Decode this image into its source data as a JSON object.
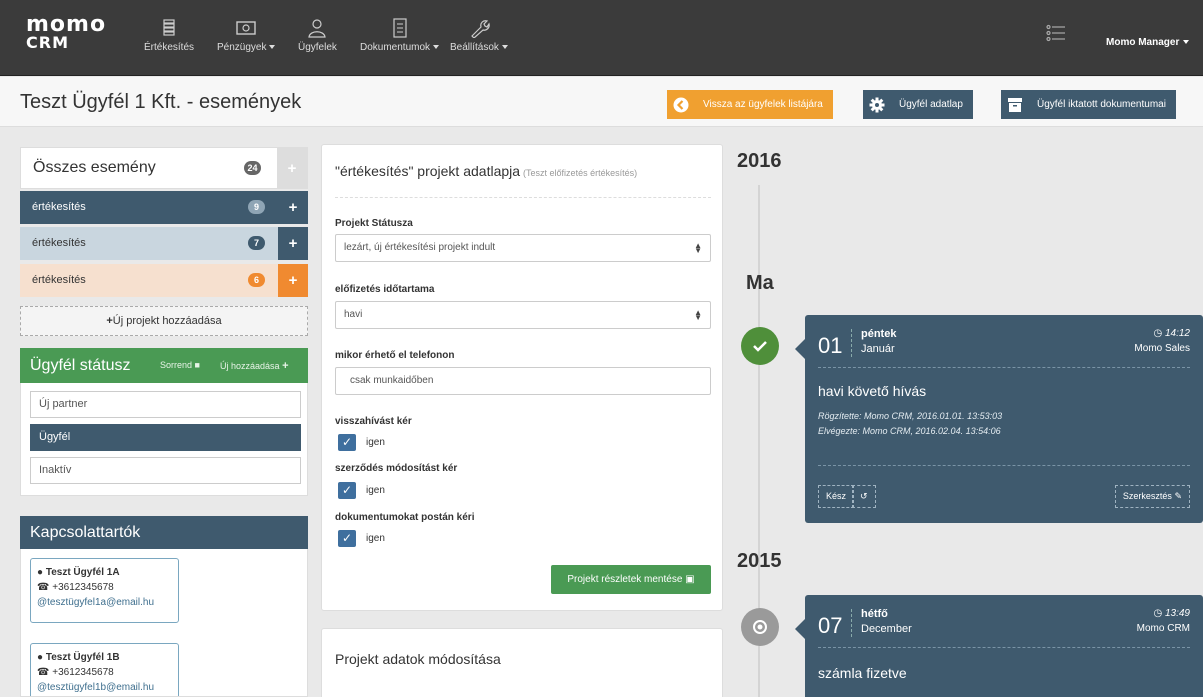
{
  "nav": {
    "logo_line1": "momo",
    "logo_line2": "CRM",
    "items": [
      {
        "label": "Értékesítés"
      },
      {
        "label": "Pénzügyek"
      },
      {
        "label": "Ügyfelek"
      },
      {
        "label": "Dokumentumok"
      },
      {
        "label": "Beállítások"
      }
    ],
    "user": "Momo Manager"
  },
  "header": {
    "title": "Teszt Ügyfél 1 Kft. - események",
    "back_label": "Vissza az ügyfelek listájára",
    "client_sheet_label": "Ügyfél adatlap",
    "documents_label": "Ügyfél iktatott dokumentumai",
    "colors": {
      "orange": "#f0a030",
      "blue": "#3f5a6e"
    }
  },
  "events_list": {
    "all_label": "Összes esemény",
    "all_count": "24",
    "projects": [
      {
        "label": "értékesítés",
        "count": "9",
        "color": "#3f5a6e"
      },
      {
        "label": "értékesítés",
        "count": "7",
        "color": "#c9d6df"
      },
      {
        "label": "értékesítés",
        "count": "6",
        "color": "#f6e0cf"
      }
    ],
    "add_project_label": "Új projekt hozzáadása"
  },
  "client_status": {
    "title": "Ügyfél státusz",
    "order_label": "Sorrend",
    "add_label": "Új hozzáadása",
    "items": [
      "Új partner",
      "Ügyfél",
      "Inaktív"
    ],
    "active": "Ügyfél"
  },
  "contacts": {
    "title": "Kapcsolattartók",
    "items": [
      {
        "name": "Teszt Ügyfél 1A",
        "phone": "+3612345678",
        "email": "tesztügyfel1a@email.hu"
      },
      {
        "name": "Teszt Ügyfél 1B",
        "phone": "+3612345678",
        "email": "tesztügyfel1b@email.hu"
      }
    ]
  },
  "project_form": {
    "title": "\"értékesítés\" projekt adatlapja",
    "subtitle": "(Teszt előfizetés értékesítés)",
    "status_label": "Projekt Státusza",
    "status_value": "lezárt, új értékesítési projekt indult",
    "duration_label": "előfizetés időtartama",
    "duration_value": "havi",
    "phone_label": "mikor érhető el telefonon",
    "phone_value": "csak munkaidőben",
    "callback_label": "visszahívást kér",
    "callback_value": "igen",
    "contract_label": "szerződés módosítást kér",
    "contract_value": "igen",
    "post_label": "dokumentumokat postán kéri",
    "post_value": "igen",
    "save_label": "Projekt részletek mentése",
    "modify_title": "Projekt adatok módosítása"
  },
  "timeline": {
    "year_2016": "2016",
    "today_label": "Ma",
    "year_2015": "2015",
    "events": [
      {
        "day": "01",
        "weekday": "péntek",
        "month": "Január",
        "time": "14:12",
        "user": "Momo Sales",
        "title": "havi követő hívás",
        "recorded": "Rögzítette: Momo CRM, 2016.01.01. 13:53:03",
        "done": "Elvégezte: Momo CRM, 2016.02.04. 13:54:06",
        "done_btn": "Kész",
        "edit_btn": "Szerkesztés",
        "status_color": "#4f8f3a"
      },
      {
        "day": "07",
        "weekday": "hétfő",
        "month": "December",
        "time": "13:49",
        "user": "Momo CRM",
        "title": "számla fizetve",
        "status_color": "#9a9a9a"
      }
    ]
  }
}
